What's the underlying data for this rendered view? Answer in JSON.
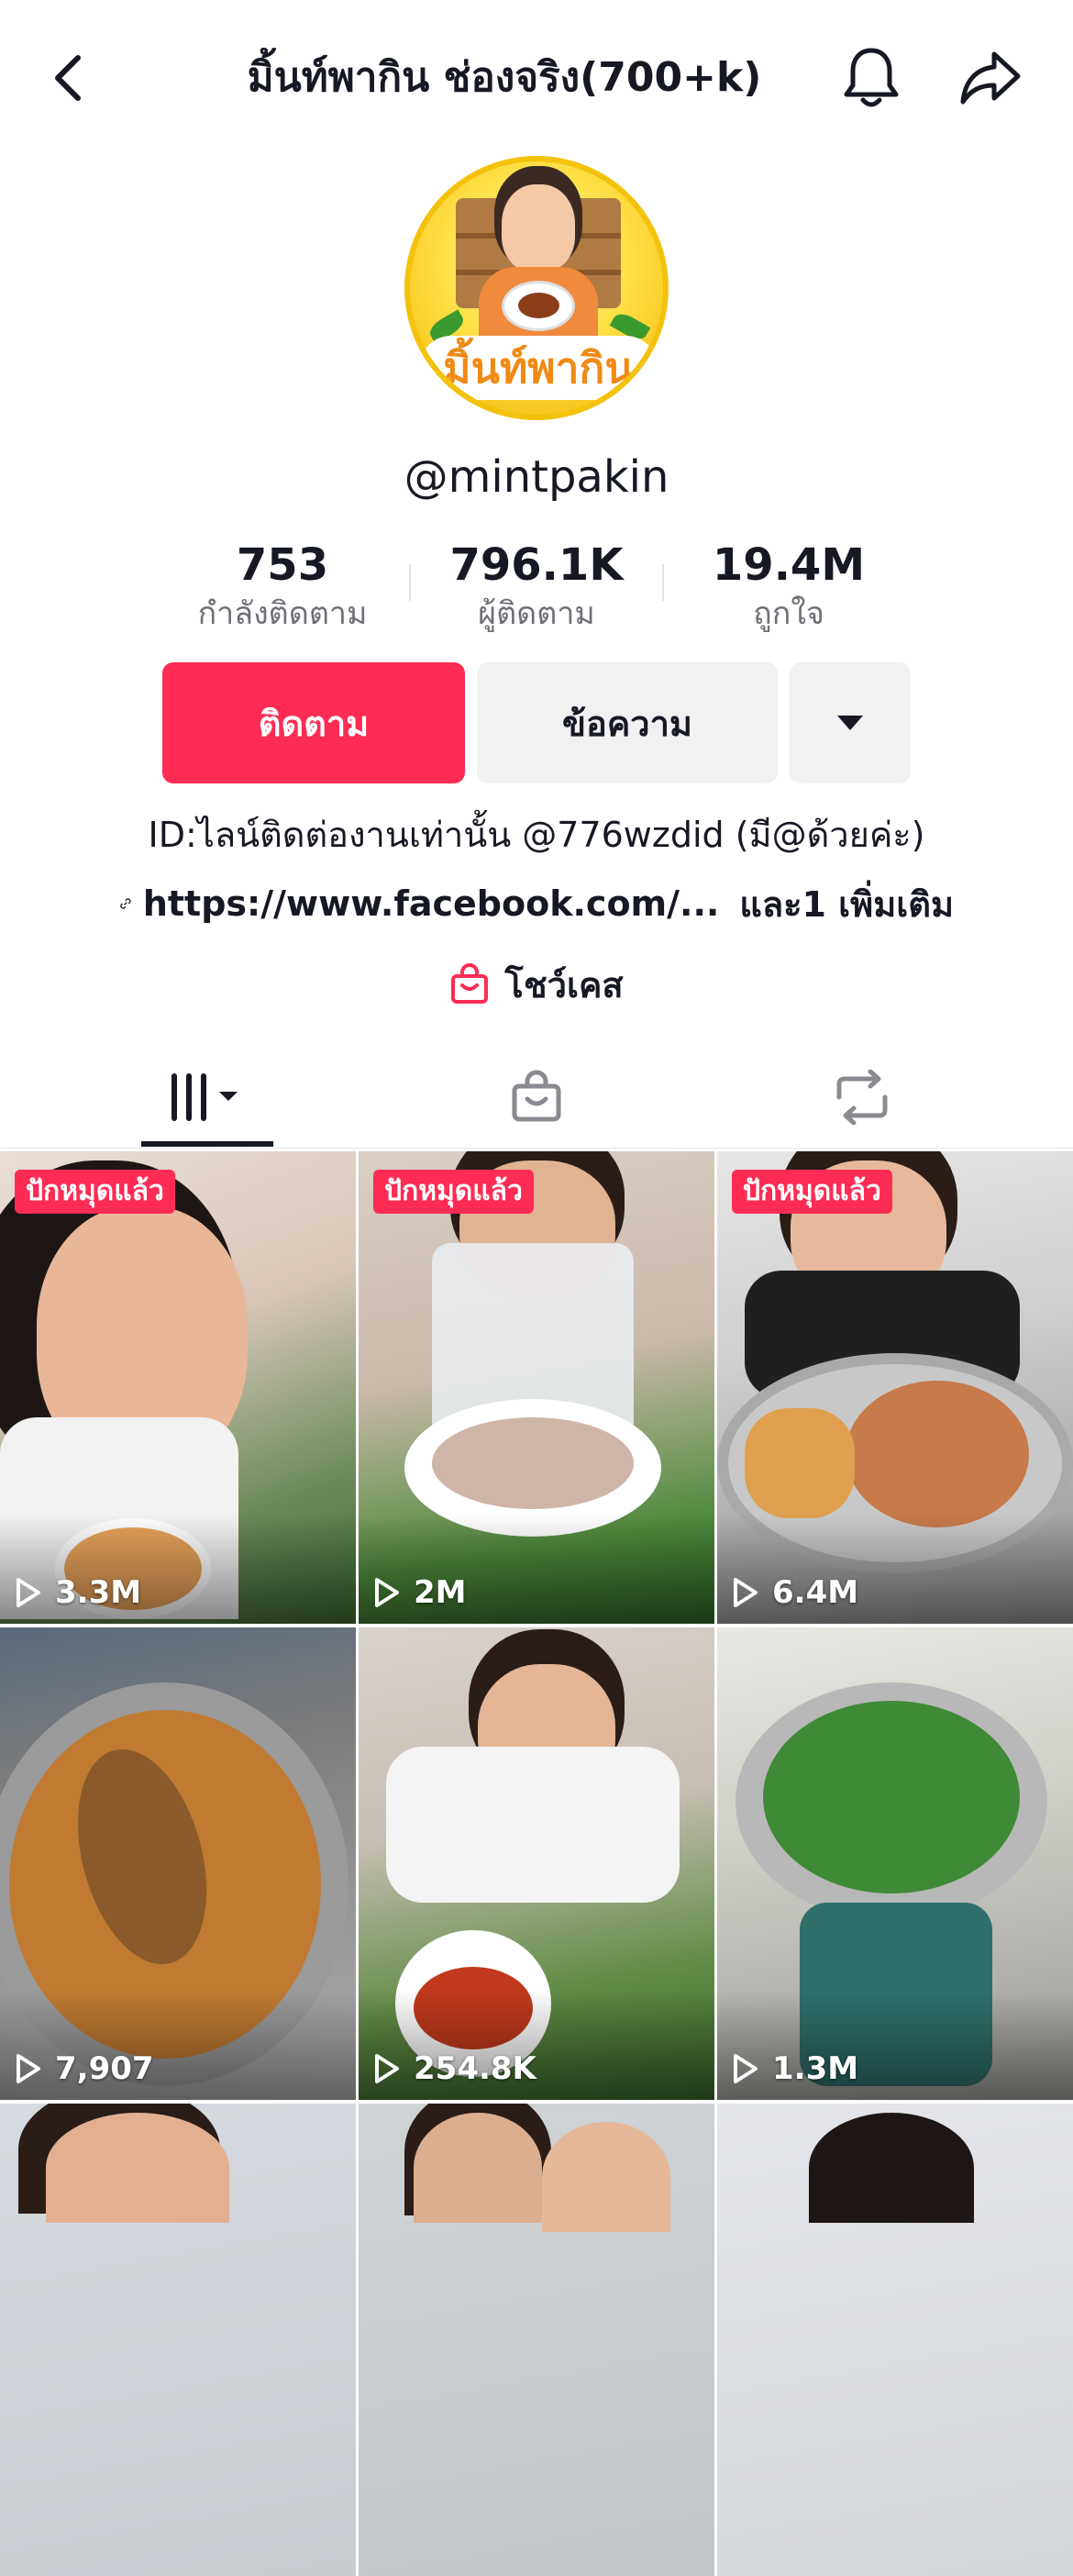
{
  "header": {
    "title": "มิ้นท์พากิน ช่องจริง(700+k)"
  },
  "profile": {
    "avatar_text": "มิ้นท์พากิน",
    "username": "@mintpakin",
    "stats": [
      {
        "value": "753",
        "label": "กำลังติดตาม"
      },
      {
        "value": "796.1K",
        "label": "ผู้ติดตาม"
      },
      {
        "value": "19.4M",
        "label": "ถูกใจ"
      }
    ],
    "follow_label": "ติดตาม",
    "message_label": "ข้อความ",
    "bio": "ID:ไลน์ติดต่องานเท่านั้น @776wzdid (มี@ด้วยค่ะ)",
    "link_url": "https://www.facebook.com/...",
    "link_more": "และ1 เพิ่มเติม",
    "showcase_label": "โชว์เคส"
  },
  "colors": {
    "accent": "#fe2c55",
    "text": "#161823",
    "secondary_text": "#6f7077",
    "button_grey": "#f1f1f2"
  },
  "tabs": [
    {
      "icon": "videos-grid-icon"
    },
    {
      "icon": "shop-bag-icon"
    },
    {
      "icon": "repost-icon"
    }
  ],
  "videos": [
    {
      "pinned": "ปักหมุดแล้ว",
      "views": "3.3M"
    },
    {
      "pinned": "ปักหมุดแล้ว",
      "views": "2M"
    },
    {
      "pinned": "ปักหมุดแล้ว",
      "views": "6.4M"
    },
    {
      "views": "7,907"
    },
    {
      "views": "254.8K"
    },
    {
      "views": "1.3M"
    },
    {},
    {},
    {}
  ]
}
